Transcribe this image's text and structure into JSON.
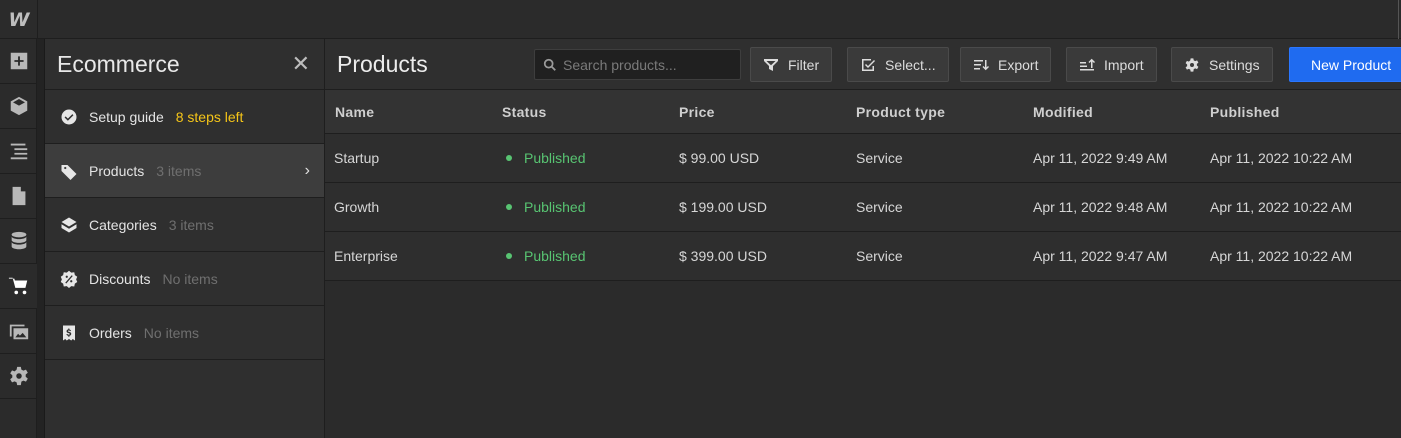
{
  "app": {
    "logo": "W"
  },
  "rail": {
    "items": [
      {
        "icon": "add-icon"
      },
      {
        "icon": "box-icon"
      },
      {
        "icon": "navigator-icon"
      },
      {
        "icon": "pages-icon"
      },
      {
        "icon": "cms-icon"
      },
      {
        "icon": "cart-icon"
      },
      {
        "icon": "assets-icon"
      },
      {
        "icon": "settings-gear-icon"
      }
    ]
  },
  "panel": {
    "title": "Ecommerce",
    "close_label": "✕",
    "items": [
      {
        "label": "Setup guide",
        "meta": "8 steps left",
        "icon": "check-circle-icon"
      },
      {
        "label": "Products",
        "meta": "3 items",
        "icon": "tag-icon",
        "chevron": "›"
      },
      {
        "label": "Categories",
        "meta": "3 items",
        "icon": "category-box-icon"
      },
      {
        "label": "Discounts",
        "meta": "No items",
        "icon": "discount-badge-icon"
      },
      {
        "label": "Orders",
        "meta": "No items",
        "icon": "receipt-icon"
      }
    ]
  },
  "main": {
    "title": "Products",
    "search_placeholder": "Search products...",
    "buttons": {
      "filter": "Filter",
      "select": "Select...",
      "export": "Export",
      "import": "Import",
      "settings": "Settings",
      "new_product": "New Product"
    },
    "table": {
      "headers": [
        "Name",
        "Status",
        "Price",
        "Product type",
        "Modified",
        "Published"
      ],
      "rows": [
        {
          "name": "Startup",
          "status": "Published",
          "price": "$ 99.00 USD",
          "type": "Service",
          "modified": "Apr 11, 2022 9:49 AM",
          "published": "Apr 11, 2022 10:22 AM"
        },
        {
          "name": "Growth",
          "status": "Published",
          "price": "$ 199.00 USD",
          "type": "Service",
          "modified": "Apr 11, 2022 9:48 AM",
          "published": "Apr 11, 2022 10:22 AM"
        },
        {
          "name": "Enterprise",
          "status": "Published",
          "price": "$ 399.00 USD",
          "type": "Service",
          "modified": "Apr 11, 2022 9:47 AM",
          "published": "Apr 11, 2022 10:22 AM"
        }
      ]
    }
  },
  "colors": {
    "accent": "#1f6bf0",
    "published": "#58c472",
    "warning": "#f5c518"
  }
}
